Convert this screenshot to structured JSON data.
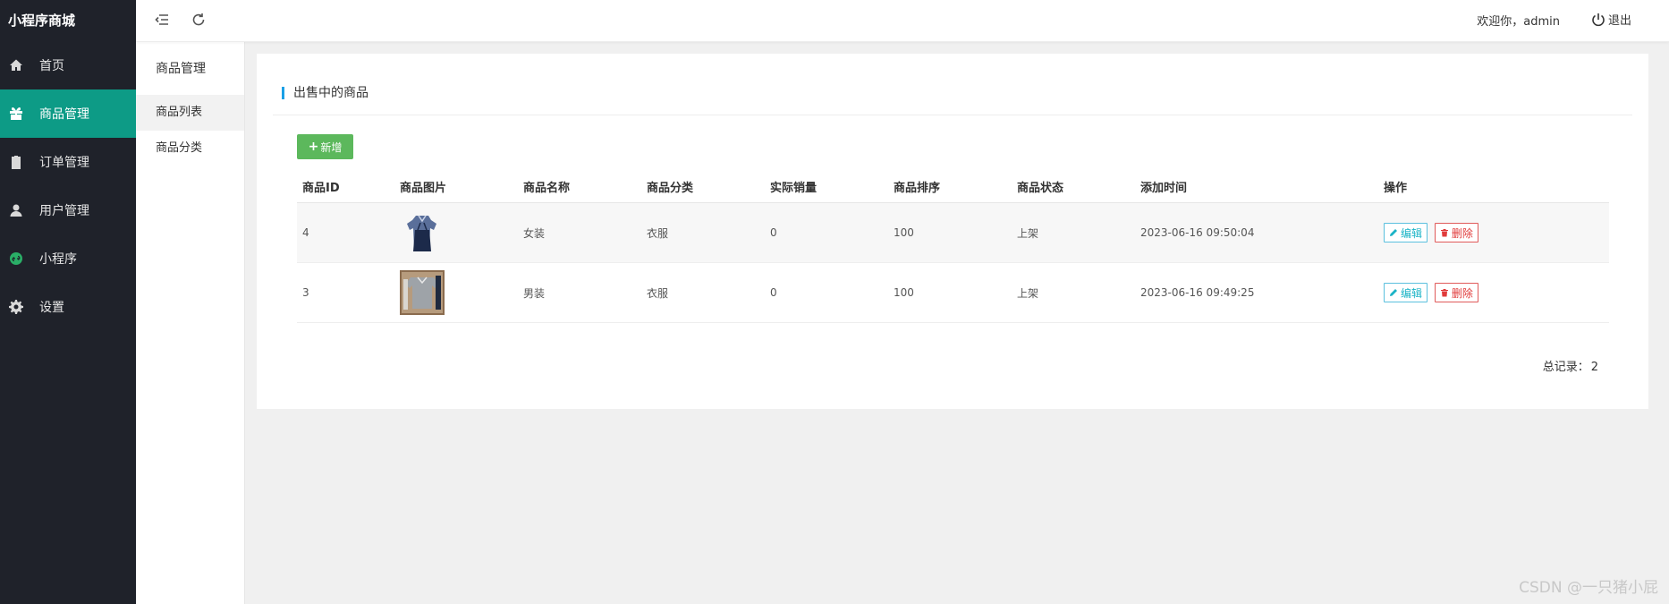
{
  "app": {
    "brand": "小程序商城"
  },
  "sidebar": {
    "items": [
      {
        "label": "首页",
        "icon": "home-icon"
      },
      {
        "label": "商品管理",
        "icon": "gift-icon",
        "active": true
      },
      {
        "label": "订单管理",
        "icon": "clipboard-icon"
      },
      {
        "label": "用户管理",
        "icon": "user-icon"
      },
      {
        "label": "小程序",
        "icon": "miniprogram-icon"
      },
      {
        "label": "设置",
        "icon": "gear-icon"
      }
    ],
    "active_color": "#0d9b86",
    "bg_color": "#1f222a"
  },
  "submenu": {
    "title": "商品管理",
    "items": [
      {
        "label": "商品列表",
        "active": true
      },
      {
        "label": "商品分类"
      }
    ]
  },
  "header": {
    "welcome": "欢迎你，admin",
    "logout": "退出"
  },
  "main": {
    "title": "出售中的商品",
    "add_button": "新增",
    "columns": [
      "商品ID",
      "商品图片",
      "商品名称",
      "商品分类",
      "实际销量",
      "商品排序",
      "商品状态",
      "添加时间",
      "操作"
    ],
    "rows": [
      {
        "id": "4",
        "image": "dress-thumbnail",
        "name": "女装",
        "category": "衣服",
        "sales": "0",
        "sort": "100",
        "status": "上架",
        "added": "2023-06-16 09:50:04",
        "edit": "编辑",
        "delete": "删除"
      },
      {
        "id": "3",
        "image": "shirt-thumbnail",
        "name": "男装",
        "category": "衣服",
        "sales": "0",
        "sort": "100",
        "status": "上架",
        "added": "2023-06-16 09:49:25",
        "edit": "编辑",
        "delete": "删除"
      }
    ],
    "total_label": "总记录：",
    "total_value": "2"
  },
  "watermark": "CSDN @一只猪小屁"
}
